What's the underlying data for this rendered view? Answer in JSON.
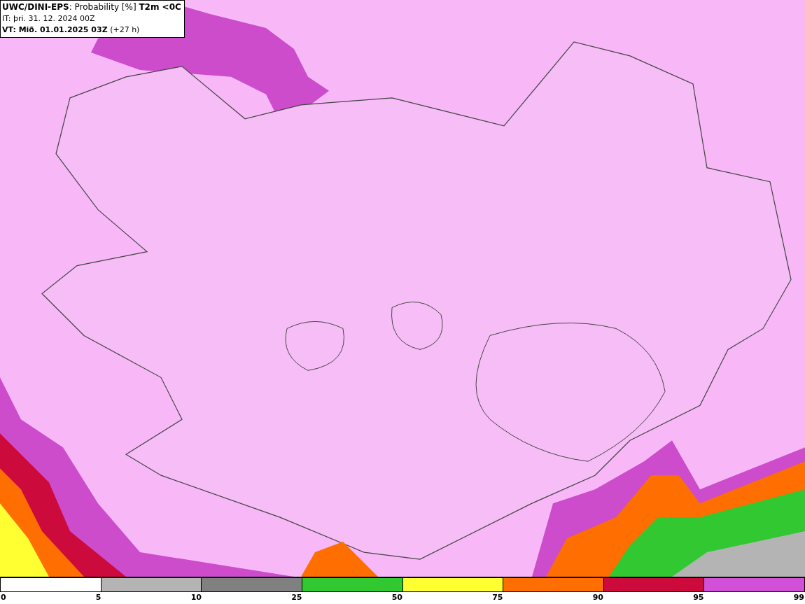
{
  "header": {
    "lines": [
      "**UWC/DINI-EPS**: Probability [%] **T2m <0C**",
      "IT: þri. 31. 12. 2024 00Z",
      "**VT: Mið. 01.01.2025 03Z** (+27 h)"
    ]
  },
  "legend": {
    "segments": [
      {
        "color": "#ffffff"
      },
      {
        "color": "#b4b4b4"
      },
      {
        "color": "#808080"
      },
      {
        "color": "#32c832"
      },
      {
        "color": "#ffff32"
      },
      {
        "color": "#ff6e00"
      },
      {
        "color": "#cd0a3c"
      },
      {
        "color": "#d050d8"
      }
    ],
    "ticks": [
      "0",
      "5",
      "10",
      "25",
      "50",
      "75",
      "90",
      "95",
      "99"
    ]
  }
}
